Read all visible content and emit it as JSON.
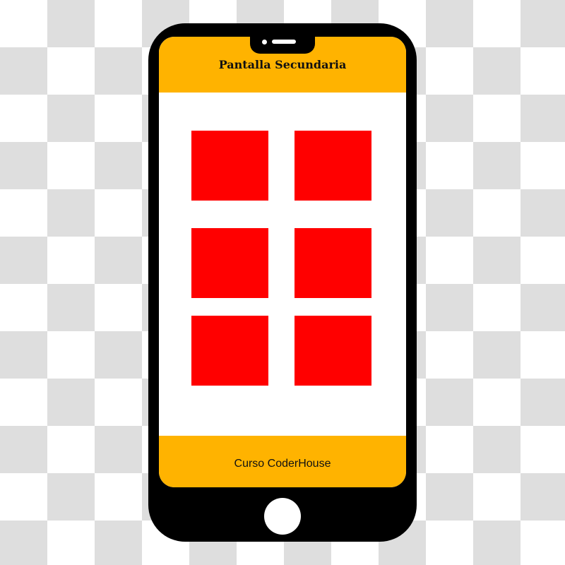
{
  "header": {
    "title": "Pantalla Secundaria"
  },
  "footer": {
    "label": "Curso CoderHouse"
  },
  "grid": {
    "rows": 3,
    "columns": 2,
    "tile_color": "#ff0000"
  },
  "colors": {
    "bar": "#ffb300",
    "device": "#000000",
    "screen": "#ffffff"
  },
  "icons": {
    "home_button": "home-button-icon",
    "camera": "camera-icon",
    "speaker": "speaker-icon"
  }
}
